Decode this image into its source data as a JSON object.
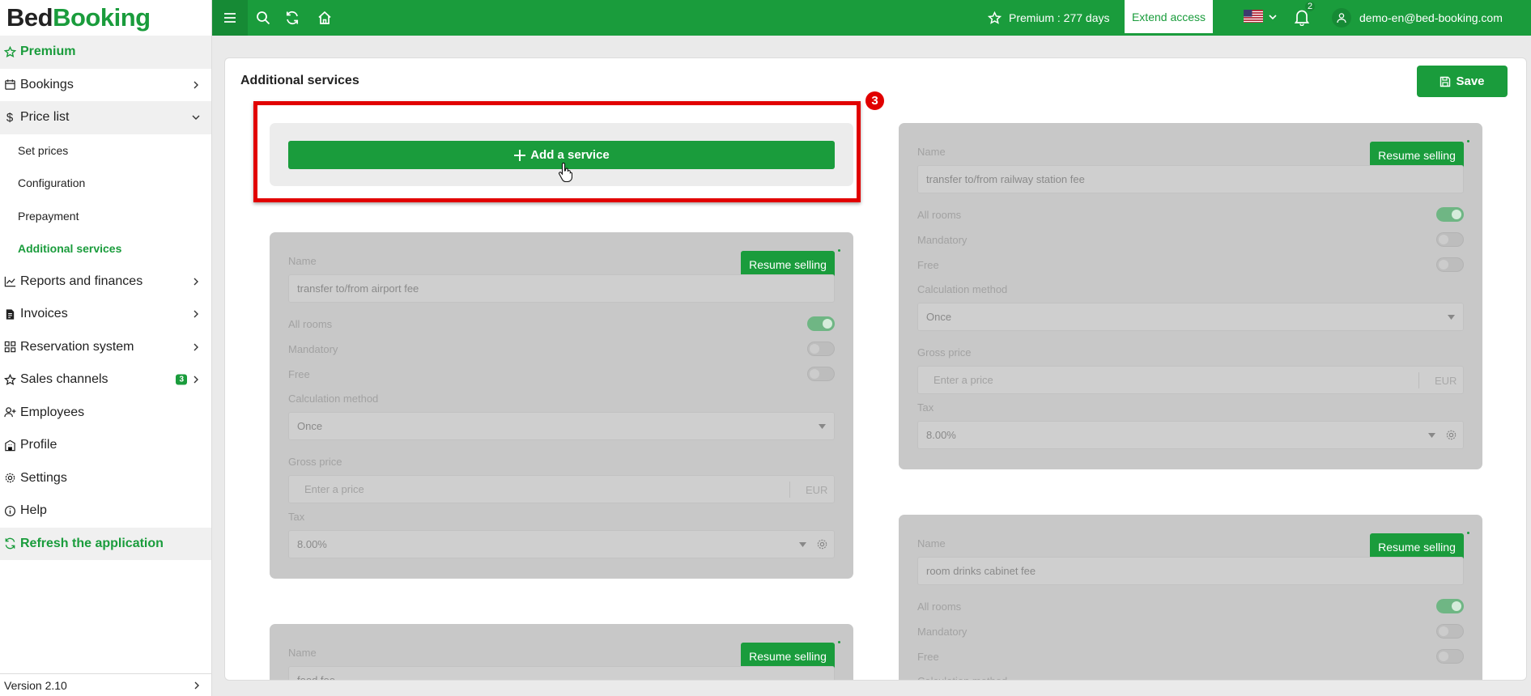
{
  "app": {
    "logo_part1": "Bed",
    "logo_part2": "Booking"
  },
  "sidebar": {
    "premium": "Premium",
    "items": [
      {
        "label": "Bookings"
      },
      {
        "label": "Price list"
      },
      {
        "label": "Set prices"
      },
      {
        "label": "Configuration"
      },
      {
        "label": "Prepayment"
      },
      {
        "label": "Additional services"
      },
      {
        "label": "Reports and finances"
      },
      {
        "label": "Invoices"
      },
      {
        "label": "Reservation system"
      },
      {
        "label": "Sales channels",
        "badge": "3"
      },
      {
        "label": "Employees"
      },
      {
        "label": "Profile"
      },
      {
        "label": "Settings"
      },
      {
        "label": "Help"
      }
    ],
    "refresh": "Refresh the application",
    "version": "Version 2.10"
  },
  "topbar": {
    "premium_text": "Premium : 277 days",
    "extend_label": "Extend access",
    "notifications_count": "2",
    "user_email": "demo-en@bed-booking.com",
    "language": "en-US"
  },
  "page": {
    "title": "Additional services",
    "save_label": "Save",
    "add_service_label": "Add a service",
    "annotation_number": "3"
  },
  "service_labels": {
    "name": "Name",
    "all_rooms": "All rooms",
    "mandatory": "Mandatory",
    "free": "Free",
    "calculation_method": "Calculation method",
    "gross_price": "Gross price",
    "price_placeholder": "Enter a price",
    "currency": "EUR",
    "tax": "Tax",
    "resume_selling": "Resume selling"
  },
  "services": [
    {
      "name": "transfer to/from airport fee",
      "all_rooms": true,
      "mandatory": false,
      "free": false,
      "calc_method": "Once",
      "tax": "8.00%"
    },
    {
      "name": "transfer to/from railway station fee",
      "all_rooms": true,
      "mandatory": false,
      "free": false,
      "calc_method": "Once",
      "tax": "8.00%"
    },
    {
      "name": "room drinks cabinet fee",
      "all_rooms": true,
      "mandatory": false,
      "free": false
    },
    {
      "name": "food fee"
    }
  ],
  "colors": {
    "brand_green": "#1a9c3c",
    "annotation_red": "#e10000",
    "disabled_card": "#c8c8c8"
  }
}
